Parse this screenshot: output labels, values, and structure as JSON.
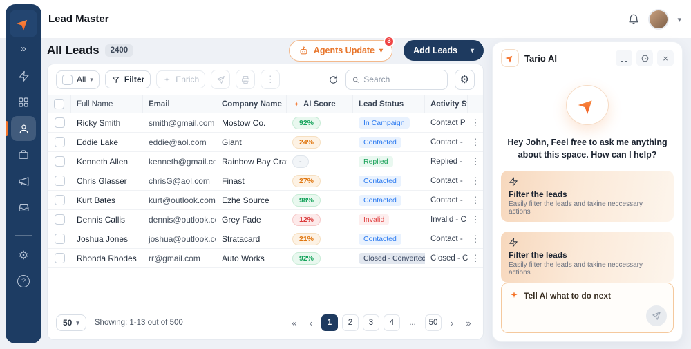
{
  "icons": {
    "collapse": "»",
    "chevron_down": "▾",
    "kebab": "⋮",
    "gear": "⚙",
    "close": "×",
    "help": "?",
    "page_first": "«",
    "page_prev": "‹",
    "page_next": "›",
    "page_last": "»"
  },
  "header": {
    "app_title": "Lead Master"
  },
  "main": {
    "title": "All Leads",
    "count_badge": "2400",
    "actions": {
      "agents_update_label": "Agents Update",
      "agents_update_badge": "3",
      "add_leads_label": "Add Leads"
    },
    "toolbar": {
      "all_label": "All",
      "filter_label": "Filter",
      "enrich_label": "Enrich",
      "search_placeholder": "Search"
    },
    "table": {
      "columns": {
        "name": "Full Name",
        "email": "Email",
        "company": "Company Name",
        "score": "AI Score",
        "status": "Lead Status",
        "activity": "Activity Status"
      },
      "rows": [
        {
          "name": "Ricky Smith",
          "email": "smith@gmail.com",
          "company": "Mostow Co.",
          "score": "92%",
          "score_variant": "green",
          "status": "In Campaign",
          "status_variant": "blue",
          "activity": "Contact P"
        },
        {
          "name": "Eddie Lake",
          "email": "eddie@aol.com",
          "company": "Giant",
          "score": "24%",
          "score_variant": "orange",
          "status": "Contacted",
          "status_variant": "blue",
          "activity": "Contact - "
        },
        {
          "name": "Kenneth Allen",
          "email": "kenneth@gmail.com",
          "company": "Rainbow Bay Crafts",
          "score": "-",
          "score_variant": "neutral",
          "status": "Replied",
          "status_variant": "green",
          "activity": "Replied - "
        },
        {
          "name": "Chris Glasser",
          "email": "chrisG@aol.com",
          "company": "Finast",
          "score": "27%",
          "score_variant": "orange",
          "status": "Contacted",
          "status_variant": "blue",
          "activity": "Contact - "
        },
        {
          "name": "Kurt Bates",
          "email": "kurt@outlook.com",
          "company": "Ezhe Source",
          "score": "98%",
          "score_variant": "green",
          "status": "Contacted",
          "status_variant": "blue",
          "activity": "Contact - "
        },
        {
          "name": "Dennis Callis",
          "email": "dennis@outlook.com",
          "company": "Grey Fade",
          "score": "12%",
          "score_variant": "red",
          "status": "Invalid",
          "status_variant": "red",
          "activity": "Invalid - C"
        },
        {
          "name": "Joshua Jones",
          "email": "joshua@outlook.com",
          "company": "Stratacard",
          "score": "21%",
          "score_variant": "orange",
          "status": "Contacted",
          "status_variant": "blue",
          "activity": "Contact - "
        },
        {
          "name": "Rhonda Rhodes",
          "email": "rr@gmail.com",
          "company": "Auto Works",
          "score": "92%",
          "score_variant": "green",
          "status": "Closed - Converted",
          "status_variant": "gray",
          "activity": "Closed - C"
        }
      ]
    },
    "footer": {
      "page_size": "50",
      "showing": "Showing: 1-13 out of 500",
      "pages": [
        "1",
        "2",
        "3",
        "4",
        "...",
        "50"
      ]
    }
  },
  "assistant": {
    "title": "Tario AI",
    "greeting": "Hey John, Feel free to ask me anything about this space. How can I help?",
    "suggestions": [
      {
        "title": "Filter the leads",
        "desc": "Easily filter the leads and takine neccessary actions"
      },
      {
        "title": "Filter the leads",
        "desc": "Easily filter the leads and takine neccessary actions"
      }
    ],
    "input_placeholder": "Tell AI what to do next"
  }
}
